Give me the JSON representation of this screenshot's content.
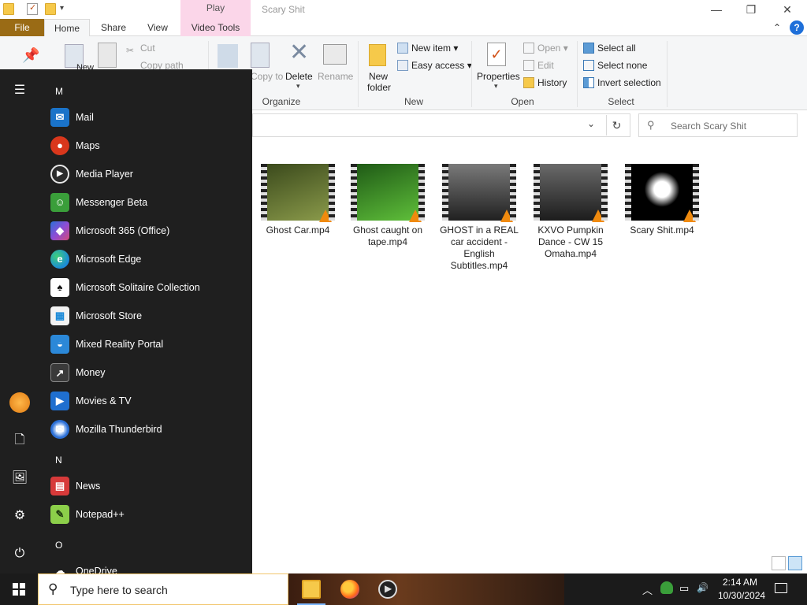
{
  "window": {
    "title": "Scary Shit",
    "context_tab": "Play",
    "minimize": "—",
    "restore": "❐",
    "close": "✕"
  },
  "ribbon_tabs": {
    "file": "File",
    "home": "Home",
    "share": "Share",
    "view": "View",
    "video_tools": "Video Tools",
    "collapse": "⌃",
    "help": "?"
  },
  "ribbon": {
    "clipboard": {
      "new": "New",
      "cut": "Cut",
      "copy_path": "Copy path"
    },
    "organize": {
      "copy_to": "Copy to",
      "delete": "Delete",
      "rename": "Rename",
      "label": "Organize"
    },
    "new": {
      "new_folder_line1": "New",
      "new_folder_line2": "folder",
      "new_item": "New item",
      "easy_access": "Easy access",
      "label": "New"
    },
    "open": {
      "properties": "Properties",
      "open": "Open",
      "edit": "Edit",
      "history": "History",
      "label": "Open"
    },
    "select": {
      "select_all": "Select all",
      "select_none": "Select none",
      "invert_selection": "Invert selection",
      "label": "Select"
    }
  },
  "address": {
    "chevron": "⌄",
    "refresh": "↻"
  },
  "search": {
    "placeholder": "Search Scary Shit",
    "icon": "search-icon"
  },
  "files": [
    {
      "name": "Ghost Car.mp4",
      "color_a": "#3b4a1c",
      "color_b": "#8a9a4a"
    },
    {
      "name": "Ghost caught on tape.mp4",
      "color_a": "#1f5a16",
      "color_b": "#5fbf3a"
    },
    {
      "name": "GHOST in a REAL car accident - English Subtitles.mp4",
      "color_a": "#202020",
      "color_b": "#7a7a7a"
    },
    {
      "name": "KXVO Pumpkin Dance - CW 15 Omaha.mp4",
      "color_a": "#1c1c1c",
      "color_b": "#6a6a6a"
    },
    {
      "name": "Scary Shit.mp4",
      "color_a": "#000000",
      "color_b": "#ffffff"
    }
  ],
  "start_menu": {
    "letters": {
      "m": "M",
      "n": "N",
      "o": "O"
    },
    "apps": [
      {
        "label": "Mail",
        "icon": "mail-icon",
        "glyph": "✉",
        "color": "#1a73c9"
      },
      {
        "label": "Maps",
        "icon": "maps-icon",
        "glyph": "●",
        "color": "#d9371c"
      },
      {
        "label": "Media Player",
        "icon": "media-player-icon",
        "glyph": "▶",
        "color": "#2c2c2c"
      },
      {
        "label": "Messenger Beta",
        "icon": "messenger-icon",
        "glyph": "☺",
        "color": "#3a9e3a"
      },
      {
        "label": "Microsoft 365 (Office)",
        "icon": "office-icon",
        "glyph": "◆",
        "color": "#6b4dd6"
      },
      {
        "label": "Microsoft Edge",
        "icon": "edge-icon",
        "glyph": "e",
        "color": "#1b8ad8"
      },
      {
        "label": "Microsoft Solitaire Collection",
        "icon": "solitaire-icon",
        "glyph": "♠",
        "color": "#ffffff"
      },
      {
        "label": "Microsoft Store",
        "icon": "store-icon",
        "glyph": "▦",
        "color": "#f2f2f2"
      },
      {
        "label": "Mixed Reality Portal",
        "icon": "mixed-reality-icon",
        "glyph": "◒",
        "color": "#2b88d8"
      },
      {
        "label": "Money",
        "icon": "money-icon",
        "glyph": "↗",
        "color": "#3a3a3a"
      },
      {
        "label": "Movies & TV",
        "icon": "movies-tv-icon",
        "glyph": "▶",
        "color": "#1f6fcf"
      },
      {
        "label": "Mozilla Thunderbird",
        "icon": "thunderbird-icon",
        "glyph": "✉",
        "color": "#2b6fd6"
      },
      {
        "label": "News",
        "icon": "news-icon",
        "glyph": "▤",
        "color": "#d73a3a"
      },
      {
        "label": "Notepad++",
        "icon": "notepad-plus-plus-icon",
        "glyph": "✎",
        "color": "#8ccf4a"
      },
      {
        "label": "OneDrive",
        "icon": "onedrive-icon",
        "glyph": "☁",
        "color": "#ffffff"
      }
    ],
    "rail": {
      "menu": "☰",
      "documents": "🗋",
      "pictures": "🖼",
      "settings": "⚙",
      "power": "⏻"
    }
  },
  "taskbar": {
    "search_placeholder": "Type here to search",
    "time": "2:14 AM",
    "date": "10/30/2024",
    "tray_chevron": "︿",
    "tray_network": "▭",
    "tray_volume": "🔊"
  }
}
